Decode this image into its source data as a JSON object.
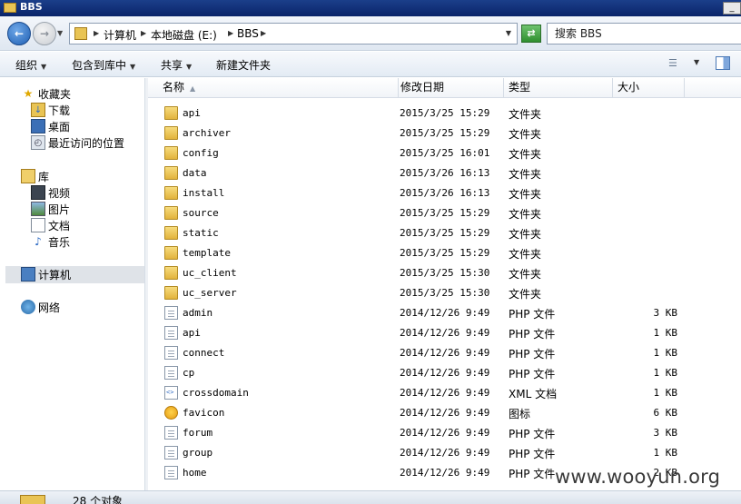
{
  "window": {
    "title": "BBS",
    "minimize_label": "_"
  },
  "address": {
    "crumbs": [
      "计算机",
      "本地磁盘 (E:)",
      "BBS"
    ],
    "search_placeholder": "搜索 BBS"
  },
  "toolbar": {
    "organize": "组织",
    "include_in_library": "包含到库中",
    "share": "共享",
    "new_folder": "新建文件夹"
  },
  "sidebar": {
    "favorites": "收藏夹",
    "downloads": "下载",
    "desktop": "桌面",
    "recent": "最近访问的位置",
    "libraries": "库",
    "videos": "视频",
    "pictures": "图片",
    "documents": "文档",
    "music": "音乐",
    "computer": "计算机",
    "network": "网络"
  },
  "columns": {
    "name": "名称",
    "modified": "修改日期",
    "type": "类型",
    "size": "大小"
  },
  "files": [
    {
      "name": "api",
      "date": "2015/3/25 15:29",
      "type": "文件夹",
      "size": "",
      "icon": "folder"
    },
    {
      "name": "archiver",
      "date": "2015/3/25 15:29",
      "type": "文件夹",
      "size": "",
      "icon": "folder"
    },
    {
      "name": "config",
      "date": "2015/3/25 16:01",
      "type": "文件夹",
      "size": "",
      "icon": "folder"
    },
    {
      "name": "data",
      "date": "2015/3/26 16:13",
      "type": "文件夹",
      "size": "",
      "icon": "folder"
    },
    {
      "name": "install",
      "date": "2015/3/26 16:13",
      "type": "文件夹",
      "size": "",
      "icon": "folder"
    },
    {
      "name": "source",
      "date": "2015/3/25 15:29",
      "type": "文件夹",
      "size": "",
      "icon": "folder"
    },
    {
      "name": "static",
      "date": "2015/3/25 15:29",
      "type": "文件夹",
      "size": "",
      "icon": "folder"
    },
    {
      "name": "template",
      "date": "2015/3/25 15:29",
      "type": "文件夹",
      "size": "",
      "icon": "folder"
    },
    {
      "name": "uc_client",
      "date": "2015/3/25 15:30",
      "type": "文件夹",
      "size": "",
      "icon": "folder"
    },
    {
      "name": "uc_server",
      "date": "2015/3/25 15:30",
      "type": "文件夹",
      "size": "",
      "icon": "folder"
    },
    {
      "name": "admin",
      "date": "2014/12/26 9:49",
      "type": "PHP 文件",
      "size": "3 KB",
      "icon": "doc"
    },
    {
      "name": "api",
      "date": "2014/12/26 9:49",
      "type": "PHP 文件",
      "size": "1 KB",
      "icon": "doc"
    },
    {
      "name": "connect",
      "date": "2014/12/26 9:49",
      "type": "PHP 文件",
      "size": "1 KB",
      "icon": "doc"
    },
    {
      "name": "cp",
      "date": "2014/12/26 9:49",
      "type": "PHP 文件",
      "size": "1 KB",
      "icon": "doc"
    },
    {
      "name": "crossdomain",
      "date": "2014/12/26 9:49",
      "type": "XML 文档",
      "size": "1 KB",
      "icon": "xmldoc"
    },
    {
      "name": "favicon",
      "date": "2014/12/26 9:49",
      "type": "图标",
      "size": "6 KB",
      "icon": "favicon"
    },
    {
      "name": "forum",
      "date": "2014/12/26 9:49",
      "type": "PHP 文件",
      "size": "3 KB",
      "icon": "doc"
    },
    {
      "name": "group",
      "date": "2014/12/26 9:49",
      "type": "PHP 文件",
      "size": "1 KB",
      "icon": "doc"
    },
    {
      "name": "home",
      "date": "2014/12/26 9:49",
      "type": "PHP 文件",
      "size": "2 KB",
      "icon": "doc"
    }
  ],
  "status": {
    "count_text": "28 个对象"
  },
  "watermark": "www.wooyun.org"
}
